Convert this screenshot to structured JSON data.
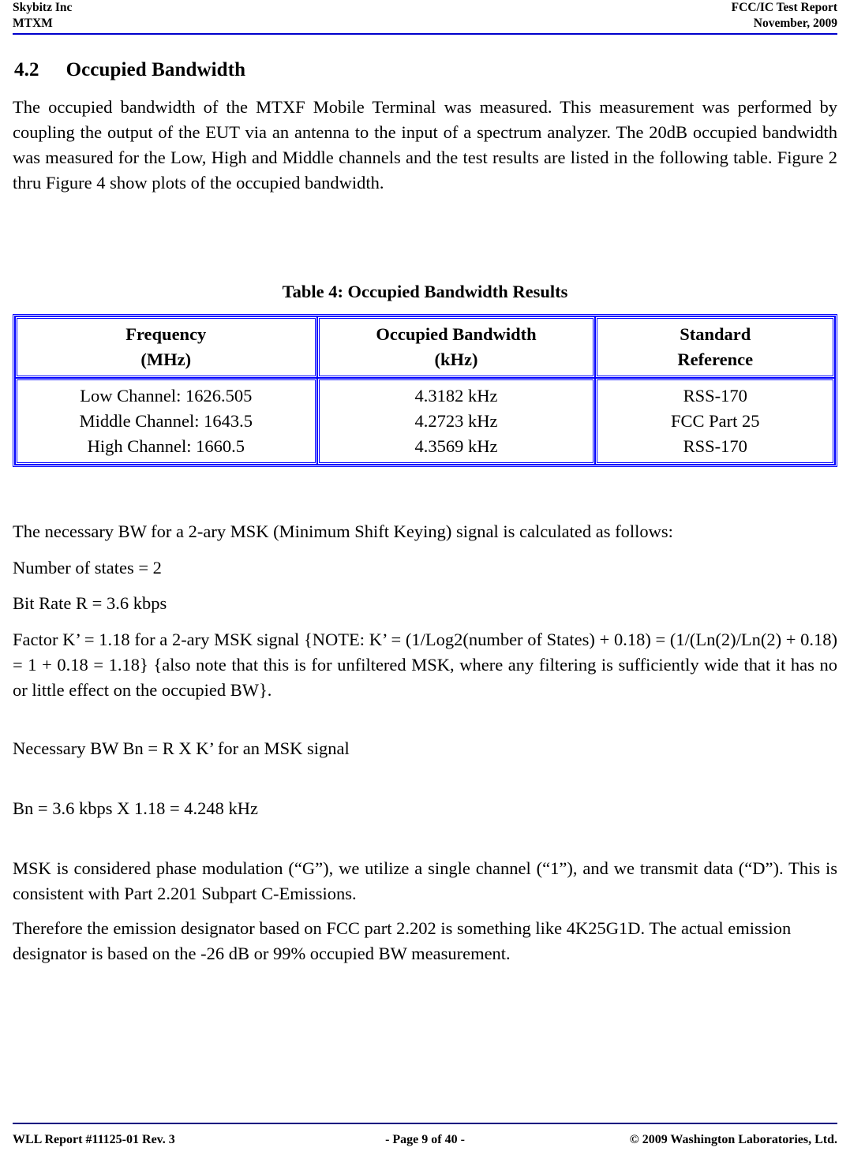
{
  "header": {
    "left_line1": "Skybitz Inc",
    "left_line2": "MTXM",
    "right_line1": "FCC/IC Test Report",
    "right_line2": "November, 2009",
    "rule_color": "#0000cc"
  },
  "section": {
    "number": "4.2",
    "title": "Occupied Bandwidth",
    "intro_paragraph": "The occupied bandwidth of the MTXF Mobile Terminal was measured. This measurement was performed by coupling the output of the EUT via an antenna to the input of a spectrum analyzer. The 20dB occupied bandwidth was measured for the Low, High and Middle channels and the test results are listed in the following table. Figure 2 thru Figure 4 show plots of the occupied bandwidth."
  },
  "table": {
    "caption": "Table 4: Occupied Bandwidth Results",
    "border_color": "#0000ff",
    "headers": [
      {
        "line1": "Frequency",
        "line2": "(MHz)"
      },
      {
        "line1": "Occupied Bandwidth",
        "line2": "(kHz)"
      },
      {
        "line1": "Standard",
        "line2": "Reference"
      }
    ],
    "rows": [
      {
        "frequency": [
          "Low Channel: 1626.505",
          "Middle Channel: 1643.5",
          "High Channel: 1660.5"
        ],
        "occupied_bandwidth": [
          "4.3182 kHz",
          "4.2723 kHz",
          "4.3569 kHz"
        ],
        "standard_reference": [
          "RSS-170",
          "FCC Part 25",
          "RSS-170"
        ]
      }
    ]
  },
  "calculations": {
    "intro": "The necessary BW for a 2-ary MSK (Minimum Shift Keying) signal is calculated as follows:",
    "states": "Number of states = 2",
    "bit_rate": "Bit Rate R = 3.6 kbps",
    "factor_paragraph": "Factor K’ = 1.18 for a 2-ary MSK signal {NOTE: K’ = (1/Log2(number of States) + 0.18) = (1/(Ln(2)/Ln(2) + 0.18) = 1 + 0.18 = 1.18} {also note that this is for unfiltered MSK, where any filtering is sufficiently wide that it has no or little effect on the occupied BW}.",
    "necessary_bw": "Necessary BW Bn = R X K’ for an MSK signal",
    "bn_result": "Bn = 3.6 kbps X 1.18 = 4.248 kHz",
    "msk_paragraph": "MSK is considered phase modulation (“G”), we utilize a single channel (“1”), and we transmit data (“D”). This is consistent with Part 2.201 Subpart C-Emissions.",
    "designator_paragraph": "Therefore the emission designator based on FCC part 2.202 is something like 4K25G1D. The actual emission designator is based on the -26 dB or 99% occupied BW measurement."
  },
  "footer": {
    "left": "WLL Report #11125-01 Rev. 3",
    "center": "- Page 9 of 40 -",
    "right": "© 2009 Washington Laboratories, Ltd.",
    "rule_color": "#000080"
  }
}
